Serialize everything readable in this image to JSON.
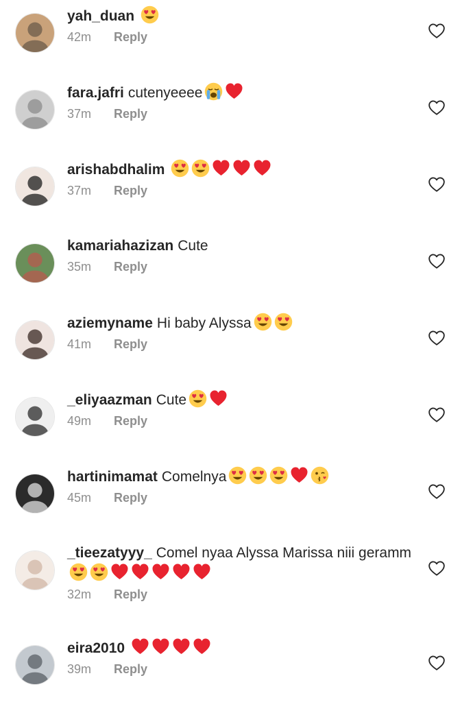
{
  "reply_label": "Reply",
  "colors": {
    "text": "#262626",
    "meta": "#8e8e8e",
    "heart": "#e8232f",
    "emoji_face": "#ffcc4d"
  },
  "comments": [
    {
      "username": "yah_duan",
      "text": "",
      "emojis": [
        "heart-eyes"
      ],
      "time": "42m",
      "avatar": "avatar-1"
    },
    {
      "username": "fara.jafri",
      "text": "cutenyeeee",
      "emojis": [
        "crying-face",
        "red-heart"
      ],
      "time": "37m",
      "avatar": "avatar-2"
    },
    {
      "username": "arishabdhalim",
      "text": "",
      "emojis": [
        "heart-eyes",
        "heart-eyes",
        "red-heart",
        "red-heart",
        "red-heart"
      ],
      "time": "37m",
      "avatar": "avatar-3"
    },
    {
      "username": "kamariahazizan",
      "text": "Cute",
      "emojis": [],
      "time": "35m",
      "avatar": "avatar-4"
    },
    {
      "username": "aziemyname",
      "text": "Hi baby Alyssa",
      "emojis": [
        "heart-eyes",
        "heart-eyes"
      ],
      "time": "41m",
      "avatar": "avatar-5"
    },
    {
      "username": "_eliyaazman",
      "text": "Cute",
      "emojis": [
        "heart-eyes",
        "red-heart"
      ],
      "time": "49m",
      "avatar": "avatar-6"
    },
    {
      "username": "hartinimamat",
      "text": "Comelnya",
      "emojis": [
        "heart-eyes",
        "heart-eyes",
        "heart-eyes",
        "red-heart",
        "kissing-face"
      ],
      "time": "45m",
      "avatar": "avatar-7"
    },
    {
      "username": "_tieezatyyy_",
      "text": "Comel nyaa Alyssa Marissa niii geramm",
      "emojis": [
        "heart-eyes",
        "heart-eyes",
        "red-heart",
        "red-heart",
        "red-heart",
        "red-heart",
        "red-heart"
      ],
      "time": "32m",
      "avatar": "avatar-8"
    },
    {
      "username": "eira2010",
      "text": "",
      "emojis": [
        "red-heart",
        "red-heart",
        "red-heart",
        "red-heart"
      ],
      "time": "39m",
      "avatar": "avatar-9"
    }
  ]
}
